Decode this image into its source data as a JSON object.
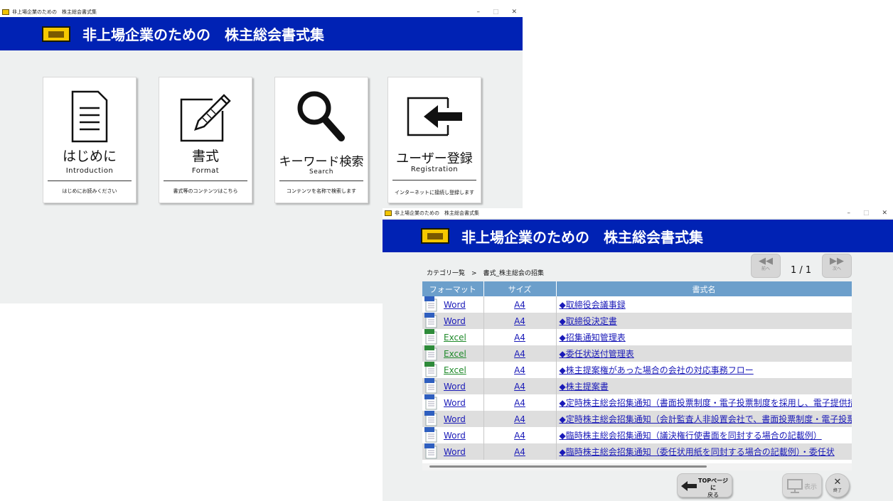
{
  "main_window": {
    "titlebar_title": "非上場企業のための　株主総会書式集",
    "banner_title": "非上場企業のための　株主総会書式集",
    "controls": {
      "minimize": "–",
      "maximize": "□",
      "close": "✕"
    },
    "cards": [
      {
        "jp": "はじめに",
        "en": "Introduction",
        "sub": "はじめにお読みください",
        "icon": "document-icon"
      },
      {
        "jp": "書式",
        "en": "Format",
        "sub": "書式等のコンテンツはこちら",
        "icon": "edit-pencil-icon"
      },
      {
        "jp": "キーワード検索",
        "en": "Search",
        "sub": "コンテンツを名称で検索します",
        "icon": "magnifier-icon"
      },
      {
        "jp": "ユーザー登録",
        "en": "Registration",
        "sub": "インターネットに接続し登録します",
        "icon": "login-arrow-icon"
      }
    ]
  },
  "sub_window": {
    "titlebar_title": "非上場企業のための　株主総会書式集",
    "banner_title": "非上場企業のための　株主総会書式集",
    "controls": {
      "minimize": "–",
      "maximize": "□",
      "close": "✕"
    },
    "breadcrumb": "カテゴリ一覧　>　書式_株主総会の招集",
    "pager": {
      "prev_label": "前へ",
      "next_label": "次へ",
      "page_text": "1 / 1"
    },
    "table": {
      "headers": [
        "フォーマット",
        "サイズ",
        "書式名"
      ],
      "rows": [
        {
          "format": "Word",
          "size": "A4",
          "name": "◆取締役会議事録"
        },
        {
          "format": "Word",
          "size": "A4",
          "name": "◆取締役決定書"
        },
        {
          "format": "Excel",
          "size": "A4",
          "name": "◆招集通知管理表"
        },
        {
          "format": "Excel",
          "size": "A4",
          "name": "◆委任状送付管理表"
        },
        {
          "format": "Excel",
          "size": "A4",
          "name": "◆株主提案権があった場合の会社の対応事務フロー"
        },
        {
          "format": "Word",
          "size": "A4",
          "name": "◆株主提案書"
        },
        {
          "format": "Word",
          "size": "A4",
          "name": "◆定時株主総会招集通知（書面投票制度・電子投票制度を採用し、電子提供措置を採"
        },
        {
          "format": "Word",
          "size": "A4",
          "name": "◆定時株主総会招集通知（会計監査人非設置会社で、書面投票制度・電子投票制度を"
        },
        {
          "format": "Word",
          "size": "A4",
          "name": "◆臨時株主総会招集通知（議決権行使書面を同封する場合の記載例）"
        },
        {
          "format": "Word",
          "size": "A4",
          "name": "◆臨時株主総会招集通知（委任状用紙を同封する場合の記載例）・委任状"
        }
      ]
    },
    "footer": {
      "top_button_label_1": "TOPページに",
      "top_button_label_2": "戻る",
      "view_button_label": "表示",
      "exit_button_label": "終了"
    }
  }
}
